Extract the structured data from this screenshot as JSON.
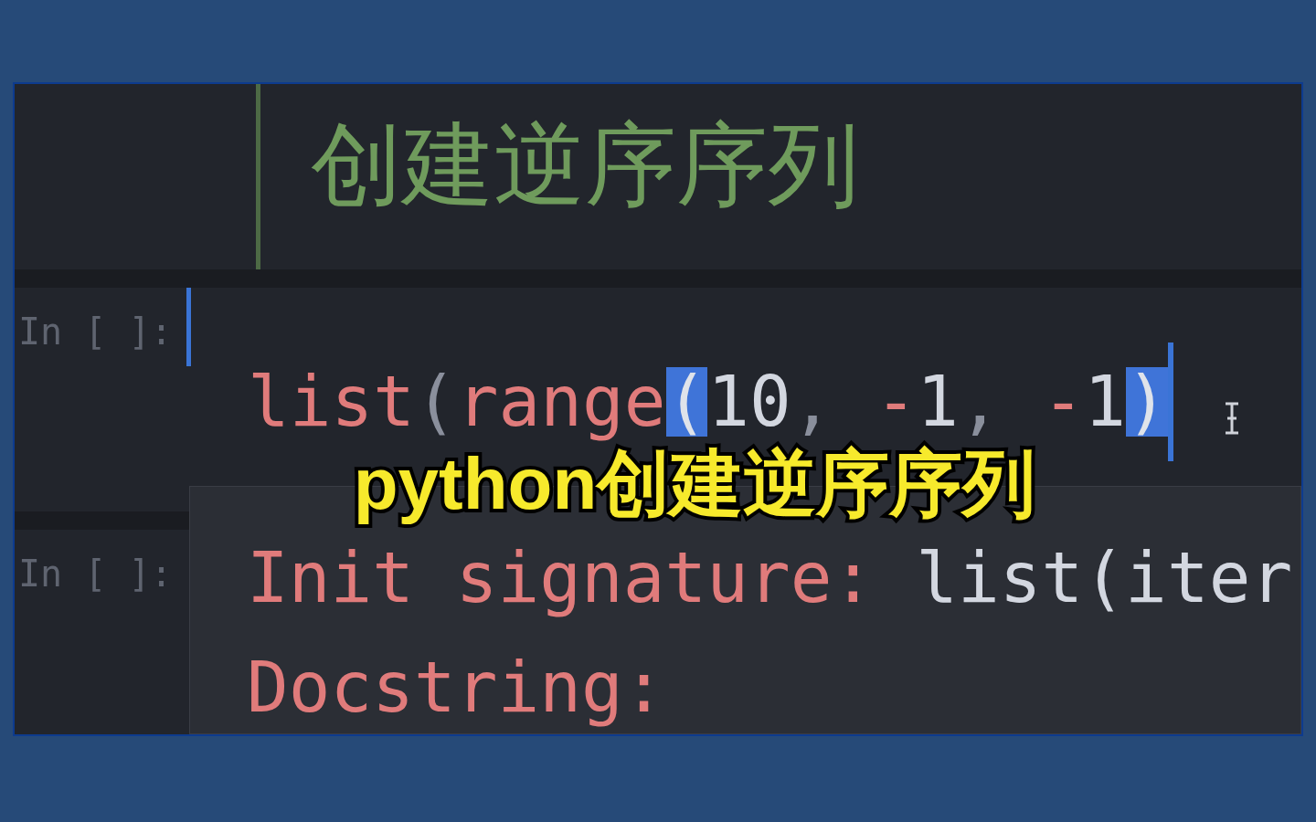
{
  "markdown_cell": {
    "heading": "创建逆序序列"
  },
  "code_cells": [
    {
      "prompt": "In [ ]:",
      "active": true,
      "code_tokens": [
        {
          "text": "list",
          "kind": "name"
        },
        {
          "text": "(",
          "kind": "punct"
        },
        {
          "text": "range",
          "kind": "name"
        },
        {
          "text": "(",
          "kind": "match"
        },
        {
          "text": "10",
          "kind": "number"
        },
        {
          "text": ", ",
          "kind": "punct"
        },
        {
          "text": "-",
          "kind": "op"
        },
        {
          "text": "1",
          "kind": "number"
        },
        {
          "text": ", ",
          "kind": "punct"
        },
        {
          "text": "-",
          "kind": "op"
        },
        {
          "text": "1",
          "kind": "number"
        },
        {
          "text": ")",
          "kind": "match"
        }
      ]
    },
    {
      "prompt": "In [ ]:",
      "active": false
    }
  ],
  "tooltip": {
    "lines": [
      {
        "label": "Init signature:",
        "value": "list(iter"
      },
      {
        "label": "Docstring:"
      }
    ]
  },
  "caption": "python创建逆序序列"
}
